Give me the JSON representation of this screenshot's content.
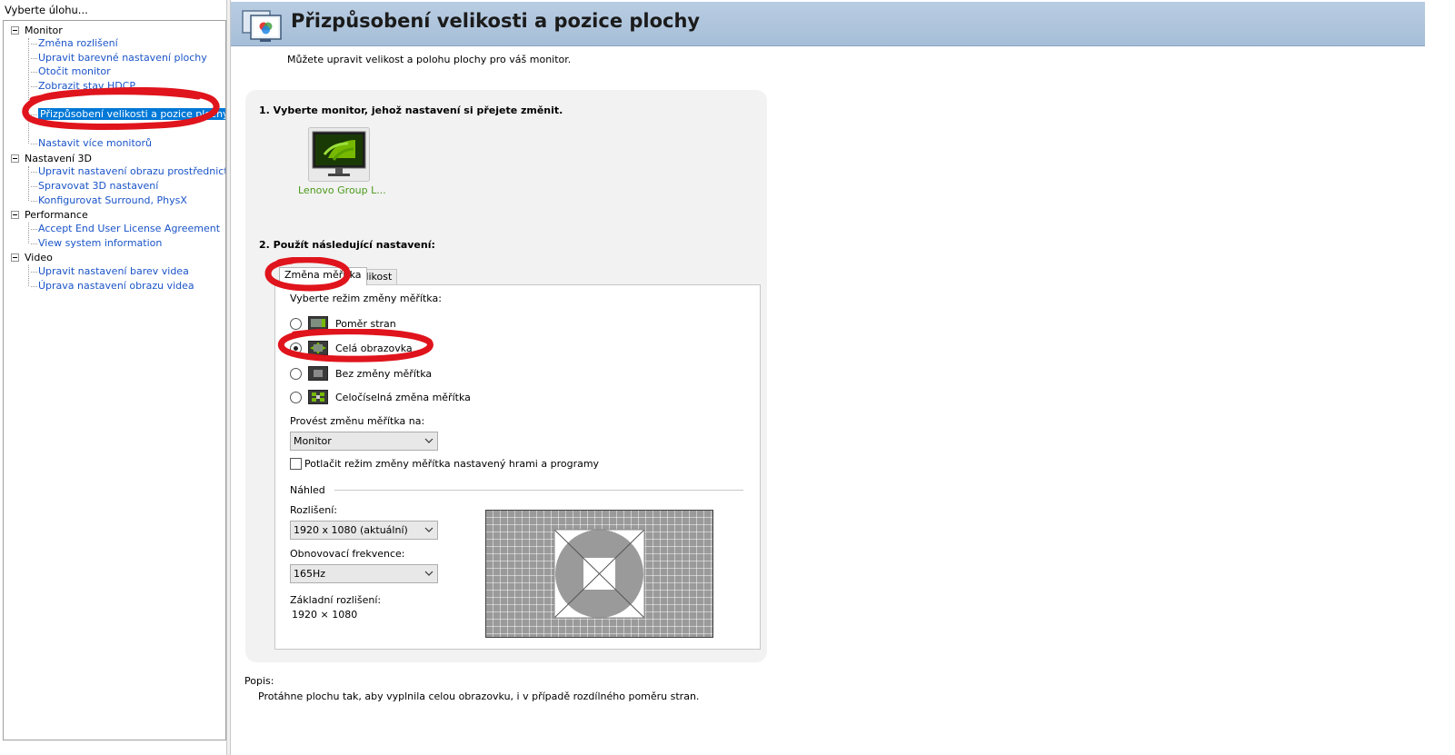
{
  "sidebar": {
    "title": "Vyberte úlohu...",
    "groups": [
      {
        "label": "Monitor",
        "items": [
          "Změna rozlišení",
          "Upravit barevné nastavení plochy",
          "Otočit monitor",
          "Zobrazit stav HDCP",
          "Přizpůsobení velikosti a pozice plochy",
          "Nastavit více monitorů"
        ]
      },
      {
        "label": "Nastavení 3D",
        "items": [
          "Upravit nastavení obrazu prostřednictvím n",
          "Spravovat 3D nastavení",
          "Konfigurovat Surround, PhysX"
        ]
      },
      {
        "label": "Performance",
        "items": [
          "Accept End User License Agreement",
          "View system information"
        ]
      },
      {
        "label": "Video",
        "items": [
          "Upravit nastavení barev videa",
          "Úprava nastavení obrazu videa"
        ]
      }
    ],
    "selected_item": "Přizpůsobení velikosti a pozice plochy"
  },
  "header": {
    "title": "Přizpůsobení velikosti a pozice plochy",
    "subtitle": "Můžete upravit velikost a polohu plochy pro váš monitor."
  },
  "section1": {
    "title": "1. Vyberte monitor, jehož nastavení si přejete změnit.",
    "monitor_label": "Lenovo Group L..."
  },
  "section2": {
    "title": "2. Použít následující nastavení:",
    "tabs": [
      "Změna měřítka",
      "Velikost"
    ],
    "active_tab": "Změna měřítka",
    "mode_prompt": "Vyberte režim změny měřítka:",
    "modes": [
      {
        "label": "Poměr stran",
        "checked": false
      },
      {
        "label": "Celá obrazovka",
        "checked": true
      },
      {
        "label": "Bez změny měřítka",
        "checked": false
      },
      {
        "label": "Celočíselná změna měřítka",
        "checked": false
      }
    ],
    "perform_on_label": "Provést změnu měřítka na:",
    "perform_on_value": "Monitor",
    "override_checkbox_label": "Potlačit režim změny měřítka nastavený hrami a programy",
    "override_checked": false,
    "preview_label": "Náhled",
    "resolution_label": "Rozlišení:",
    "resolution_value": "1920 x 1080 (aktuální)",
    "refresh_label": "Obnovovací frekvence:",
    "refresh_value": "165Hz",
    "base_resolution_label": "Základní rozlišení:",
    "base_resolution_value": "1920 × 1080"
  },
  "description": {
    "label": "Popis:",
    "text": "Protáhne plochu tak, aby vyplnila celou obrazovku, i v případě rozdílného poměru stran."
  },
  "colors": {
    "link_blue": "#1a54c8",
    "selection_blue": "#0078d7",
    "header_blue": "#a6bed8",
    "nvidia_green": "#76b900",
    "marker_red": "#e0141c"
  },
  "icons": {
    "header": "display-settings-icon",
    "monitor": "nvidia-monitor-icon",
    "modes": [
      "aspect-ratio-icon",
      "full-screen-icon",
      "no-scaling-icon",
      "integer-scaling-icon"
    ]
  }
}
